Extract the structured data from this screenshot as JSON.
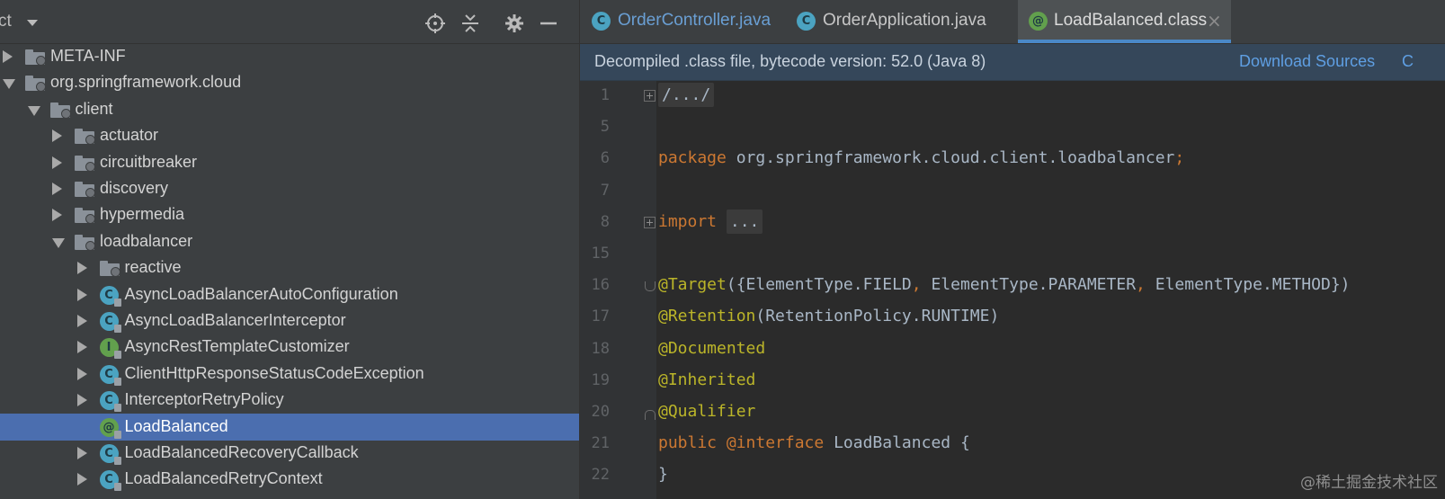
{
  "project_panel": {
    "title": "ct",
    "header_icons": [
      "locate-icon",
      "collapse-all-icon",
      "gear-icon",
      "minimize-icon"
    ],
    "tree": [
      {
        "label": "META-INF",
        "kind": "folder",
        "state": "collapsed",
        "depth": 0
      },
      {
        "label": "org.springframework.cloud",
        "kind": "folder",
        "state": "expanded",
        "depth": 0
      },
      {
        "label": "client",
        "kind": "folder",
        "state": "expanded",
        "depth": 1
      },
      {
        "label": "actuator",
        "kind": "folder",
        "state": "collapsed",
        "depth": 2
      },
      {
        "label": "circuitbreaker",
        "kind": "folder",
        "state": "collapsed",
        "depth": 2
      },
      {
        "label": "discovery",
        "kind": "folder",
        "state": "collapsed",
        "depth": 2
      },
      {
        "label": "hypermedia",
        "kind": "folder",
        "state": "collapsed",
        "depth": 2
      },
      {
        "label": "loadbalancer",
        "kind": "folder",
        "state": "expanded",
        "depth": 2
      },
      {
        "label": "reactive",
        "kind": "folder",
        "state": "collapsed",
        "depth": 3
      },
      {
        "label": "AsyncLoadBalancerAutoConfiguration",
        "kind": "class",
        "icon": "C",
        "state": "collapsed",
        "depth": 3
      },
      {
        "label": "AsyncLoadBalancerInterceptor",
        "kind": "class",
        "icon": "C",
        "state": "collapsed",
        "depth": 3
      },
      {
        "label": "AsyncRestTemplateCustomizer",
        "kind": "interface",
        "icon": "I",
        "state": "collapsed",
        "depth": 3
      },
      {
        "label": "ClientHttpResponseStatusCodeException",
        "kind": "class",
        "icon": "C",
        "state": "collapsed",
        "depth": 3
      },
      {
        "label": "InterceptorRetryPolicy",
        "kind": "class",
        "icon": "C",
        "state": "collapsed",
        "depth": 3
      },
      {
        "label": "LoadBalanced",
        "kind": "annotation",
        "icon": "@",
        "state": "none",
        "depth": 3,
        "selected": true
      },
      {
        "label": "LoadBalancedRecoveryCallback",
        "kind": "class",
        "icon": "C",
        "state": "collapsed",
        "depth": 3
      },
      {
        "label": "LoadBalancedRetryContext",
        "kind": "class",
        "icon": "C",
        "state": "collapsed",
        "depth": 3
      }
    ]
  },
  "editor": {
    "tabs": [
      {
        "label": "OrderController.java",
        "icon": "C",
        "active": false
      },
      {
        "label": "OrderApplication.java",
        "icon": "C",
        "active": false
      },
      {
        "label": "LoadBalanced.class",
        "icon": "@",
        "active": true,
        "close": "×"
      }
    ],
    "info_bar": {
      "message": "Decompiled .class file, bytecode version: 52.0 (Java 8)",
      "download_link": "Download Sources",
      "choose_link": "C"
    },
    "lines": [
      {
        "num": "1",
        "fold": "plus",
        "tokens": [
          {
            "t": "/.../",
            "c": "folded"
          }
        ]
      },
      {
        "num": "5",
        "fold": "",
        "tokens": []
      },
      {
        "num": "6",
        "fold": "",
        "tokens": [
          {
            "t": "package ",
            "c": "kw"
          },
          {
            "t": "org.springframework.cloud.client.loadbalancer",
            "c": "plain"
          },
          {
            "t": ";",
            "c": "kw"
          }
        ]
      },
      {
        "num": "7",
        "fold": "",
        "tokens": []
      },
      {
        "num": "8",
        "fold": "plus",
        "tokens": [
          {
            "t": "import ",
            "c": "kw"
          },
          {
            "t": "...",
            "c": "folded"
          }
        ]
      },
      {
        "num": "15",
        "fold": "",
        "tokens": []
      },
      {
        "num": "16",
        "fold": "start",
        "tokens": [
          {
            "t": "@Target",
            "c": "ann"
          },
          {
            "t": "({ElementType.",
            "c": "plain"
          },
          {
            "t": "FIELD",
            "c": "plain"
          },
          {
            "t": ", ",
            "c": "kw"
          },
          {
            "t": "ElementType.",
            "c": "plain"
          },
          {
            "t": "PARAMETER",
            "c": "plain"
          },
          {
            "t": ", ",
            "c": "kw"
          },
          {
            "t": "ElementType.",
            "c": "plain"
          },
          {
            "t": "METHOD",
            "c": "plain"
          },
          {
            "t": "})",
            "c": "plain"
          }
        ]
      },
      {
        "num": "17",
        "fold": "",
        "tokens": [
          {
            "t": "@Retention",
            "c": "ann"
          },
          {
            "t": "(RetentionPolicy.",
            "c": "plain"
          },
          {
            "t": "RUNTIME",
            "c": "plain"
          },
          {
            "t": ")",
            "c": "plain"
          }
        ]
      },
      {
        "num": "18",
        "fold": "",
        "tokens": [
          {
            "t": "@Documented",
            "c": "ann"
          }
        ]
      },
      {
        "num": "19",
        "fold": "",
        "tokens": [
          {
            "t": "@Inherited",
            "c": "ann"
          }
        ]
      },
      {
        "num": "20",
        "fold": "end",
        "tokens": [
          {
            "t": "@Qualifier",
            "c": "ann"
          }
        ]
      },
      {
        "num": "21",
        "fold": "",
        "tokens": [
          {
            "t": "public ",
            "c": "kw"
          },
          {
            "t": "@interface ",
            "c": "kw"
          },
          {
            "t": "LoadBalanced {",
            "c": "plain"
          }
        ]
      },
      {
        "num": "22",
        "fold": "",
        "tokens": [
          {
            "t": "}",
            "c": "plain"
          }
        ]
      }
    ]
  },
  "watermark": "@稀土掘金技术社区",
  "colors": {
    "panel_bg": "#3c3f41",
    "editor_bg": "#2b2b2b",
    "selection": "#4b6eaf",
    "keyword": "#cc7832",
    "annotation": "#bbb529",
    "link": "#5f9fe3"
  }
}
